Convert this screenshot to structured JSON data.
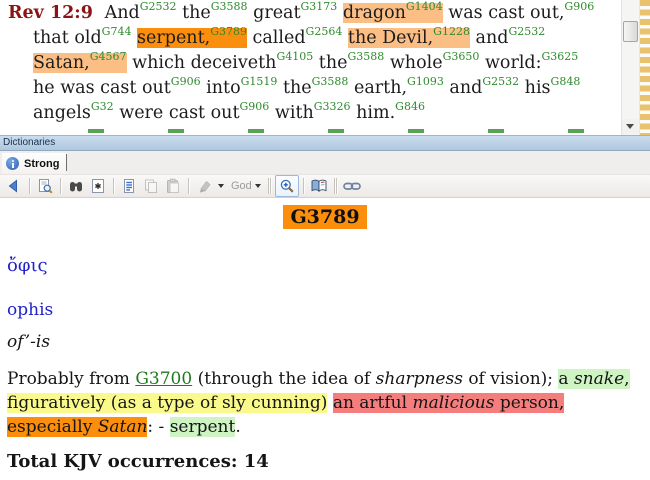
{
  "window": {
    "panel_title": "Dictionaries",
    "tab_label": "Strong"
  },
  "bible": {
    "lines": [
      {
        "indent": false,
        "join": true,
        "segments": [
          {
            "t": "Rev 12:9 ",
            "cls": "ref"
          },
          {
            "t": "And",
            "s": "G2532"
          },
          {
            "t": "the",
            "s": "G3588"
          },
          {
            "t": "great",
            "s": "G3173"
          },
          {
            "t": "dragon",
            "s": "G1404",
            "hl": "lightorange"
          },
          {
            "t": "was cast out,",
            "s": "G906"
          }
        ]
      },
      {
        "indent": true,
        "join": true,
        "segments": [
          {
            "t": "that old",
            "s": "G744"
          },
          {
            "t": "serpent,",
            "s": "G3789",
            "hl": "orange"
          },
          {
            "t": "called",
            "s": "G2564"
          },
          {
            "t": "the Devil,",
            "s": "G1228",
            "hl": "lightorange"
          },
          {
            "t": "and",
            "s": "G2532"
          }
        ]
      },
      {
        "indent": true,
        "join": true,
        "segments": [
          {
            "t": "Satan,",
            "s": "G4567",
            "hl": "lightorange"
          },
          {
            "t": "which deceiveth",
            "s": "G4105"
          },
          {
            "t": "the",
            "s": "G3588"
          },
          {
            "t": "whole",
            "s": "G3650"
          },
          {
            "t": "world:",
            "s": "G3625"
          }
        ]
      },
      {
        "indent": true,
        "join": true,
        "segments": [
          {
            "t": "he was cast out",
            "s": "G906"
          },
          {
            "t": "into",
            "s": "G1519"
          },
          {
            "t": "the",
            "s": "G3588"
          },
          {
            "t": "earth,",
            "s": "G1093"
          },
          {
            "t": "and",
            "s": "G2532"
          },
          {
            "t": "his",
            "s": "G848"
          }
        ]
      },
      {
        "indent": true,
        "join": true,
        "segments": [
          {
            "t": "angels",
            "s": "G32"
          },
          {
            "t": "were cast out",
            "s": "G906"
          },
          {
            "t": "with",
            "s": "G3326"
          },
          {
            "t": "him.",
            "s": "G846"
          }
        ]
      }
    ]
  },
  "toolbar": {
    "tint_label": "God",
    "items": [
      {
        "icon": "back-arrow-icon",
        "enabled": true
      },
      {
        "icon": "dictionary-lookup-icon",
        "enabled": true
      },
      {
        "icon": "binoculars-search-icon",
        "enabled": true
      },
      {
        "icon": "search-document-icon",
        "enabled": true
      },
      {
        "icon": "select-all-icon",
        "enabled": true
      },
      {
        "icon": "copy-icon",
        "enabled": false
      },
      {
        "icon": "paste-icon",
        "enabled": false
      },
      {
        "icon": "highlighter-icon",
        "enabled": false
      },
      {
        "icon": "tint-dropdown",
        "enabled": false
      },
      {
        "icon": "zoom-in-icon",
        "enabled": true
      },
      {
        "icon": "book-view-icon",
        "enabled": true
      },
      {
        "icon": "link-chain-icon",
        "enabled": true
      }
    ]
  },
  "dictionary": {
    "headword": "G3789",
    "greek": "ὄφις",
    "transliteration": "ophis",
    "pronunciation": "of’-is",
    "definition_lines": [
      {
        "segments": [
          {
            "t": "Probably from "
          },
          {
            "t": "G3700",
            "link": true
          },
          {
            "t": " (through the idea of "
          },
          {
            "t": "sharpness",
            "i": true
          },
          {
            "t": " of vision); "
          },
          {
            "t": "a ",
            "hl": "green"
          },
          {
            "t": "snake",
            "hl": "green",
            "i": true
          },
          {
            "t": ",",
            "hl": "green"
          }
        ]
      },
      {
        "segments": [
          {
            "t": "figuratively (as a type of sly cunning)",
            "hl": "yellow"
          },
          {
            "t": " "
          },
          {
            "t": "an artful ",
            "hl": "red"
          },
          {
            "t": "malicious",
            "hl": "red",
            "i": true
          },
          {
            "t": " person,",
            "hl": "red"
          }
        ]
      },
      {
        "segments": [
          {
            "t": "especially ",
            "hl": "orange"
          },
          {
            "t": "Satan",
            "hl": "orange",
            "i": true
          },
          {
            "t": ": - "
          },
          {
            "t": "serpent",
            "hl": "green"
          },
          {
            "t": "."
          }
        ]
      }
    ],
    "total_text": "Total KJV occurrences: 14"
  },
  "colors": {
    "hl-orange": "#FB8E0D",
    "hl-lightorange": "#FBBE85",
    "hl-yellow": "#FAFA8C",
    "hl-green": "#CDF4C2",
    "hl-red": "#F47E7E",
    "strongs-green": "#2E8B2E",
    "link-green": "#1F7A1F",
    "verse-ref-red": "#8B1414",
    "blue": "#2121CC",
    "titlebar-blue": "#BDD0E4"
  }
}
